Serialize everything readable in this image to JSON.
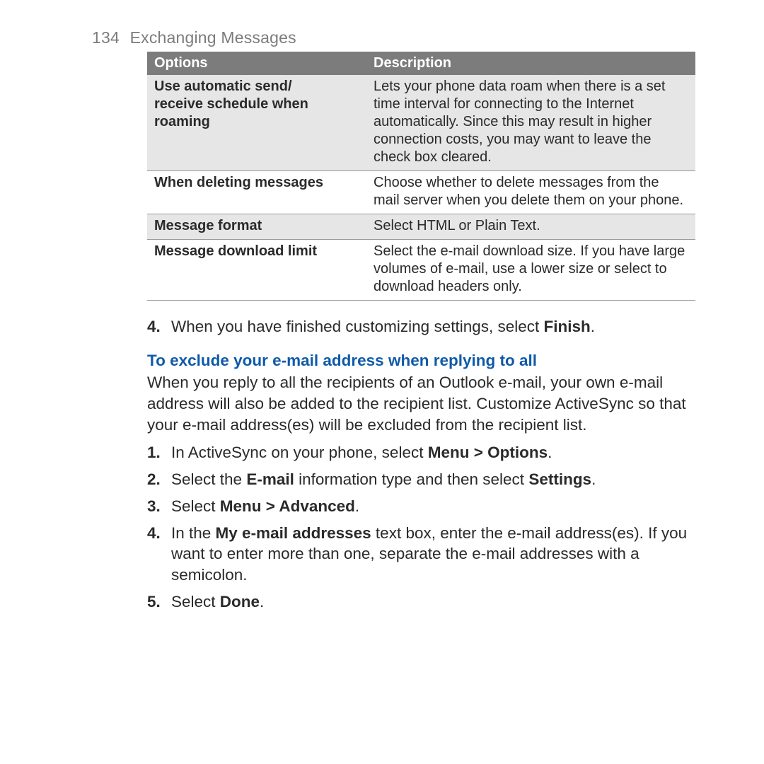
{
  "page": {
    "number": "134",
    "title": "Exchanging Messages"
  },
  "table": {
    "headers": {
      "options": "Options",
      "description": "Description"
    },
    "rows": [
      {
        "option_html": "Use automatic send/<br>receive schedule when<br>roaming",
        "description": "Lets your phone data roam when there is a set time interval for connecting to the Internet automatically. Since this may result in higher connection costs, you may want to leave the check box cleared.",
        "band": true
      },
      {
        "option_html": "When deleting messages",
        "description": "Choose whether to delete messages from the mail server when you delete them on your phone.",
        "band": false
      },
      {
        "option_html": "Message format",
        "description": "Select HTML or Plain Text.",
        "band": true
      },
      {
        "option_html": "Message download limit",
        "description": "Select the e-mail download size. If you have large volumes of e-mail, use a lower size or select to download headers only.",
        "band": false
      }
    ]
  },
  "step4": {
    "num": "4.",
    "text_html": "When you have finished customizing settings, select <strong>Finish</strong>."
  },
  "section": {
    "heading": "To exclude your e-mail address when replying to all",
    "intro": "When you reply to all the recipients of an Outlook e-mail, your own e-mail address will also be added to the recipient list. Customize ActiveSync so that your e-mail address(es) will be excluded from the recipient list.",
    "steps": [
      {
        "num": "1.",
        "text_html": "In ActiveSync on your phone, select <strong>Menu > Options</strong>."
      },
      {
        "num": "2.",
        "text_html": "Select the <strong>E-mail</strong> information type and then select <strong>Settings</strong>."
      },
      {
        "num": "3.",
        "text_html": "Select <strong>Menu > Advanced</strong>."
      },
      {
        "num": "4.",
        "text_html": "In the <strong>My e-mail addresses</strong> text box, enter the e-mail address(es). If you want to enter more than one, separate the e-mail addresses with a semicolon."
      },
      {
        "num": "5.",
        "text_html": "Select <strong>Done</strong>."
      }
    ]
  }
}
